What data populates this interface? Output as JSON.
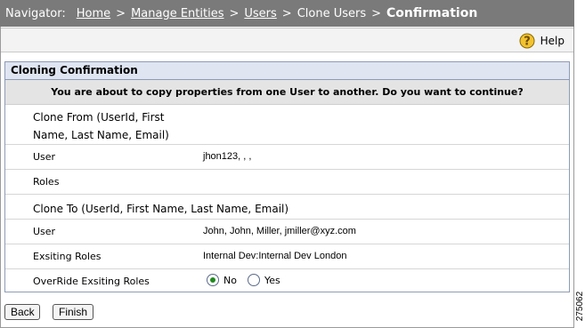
{
  "navigator": {
    "prefix": "Navigator:",
    "sep": ">",
    "crumbs": [
      "Home",
      "Manage Entities",
      "Users",
      "Clone Users"
    ],
    "current": "Confirmation"
  },
  "help": {
    "label": "Help",
    "icon": "help-question-icon"
  },
  "panel": {
    "title": "Cloning Confirmation",
    "message": "You are about to copy properties from one User to another. Do you want to continue?",
    "clone_from_heading": "Clone From (UserId, First Name, Last Name, Email)",
    "from_user_label": "User",
    "from_user_value": "jhon123, , ,",
    "roles_label": "Roles",
    "clone_to_heading": "Clone To (UserId, First Name, Last Name, Email)",
    "to_user_label": "User",
    "to_user_value": "John, John, Miller, jmiller@xyz.com",
    "existing_roles_label": "Exsiting Roles",
    "existing_roles_value": "Internal Dev:Internal Dev London",
    "override_label": "OverRide Exsiting Roles",
    "override_options": [
      "No",
      "Yes"
    ],
    "override_selected": "No"
  },
  "buttons": {
    "back": "Back",
    "finish": "Finish"
  },
  "figure_id": "275062",
  "colors": {
    "navbar": "#7a7a7a",
    "panel_title_bg": "#dfe5f1",
    "message_bg": "#e4e4e4",
    "radio_checked": "#1f8a1f"
  }
}
